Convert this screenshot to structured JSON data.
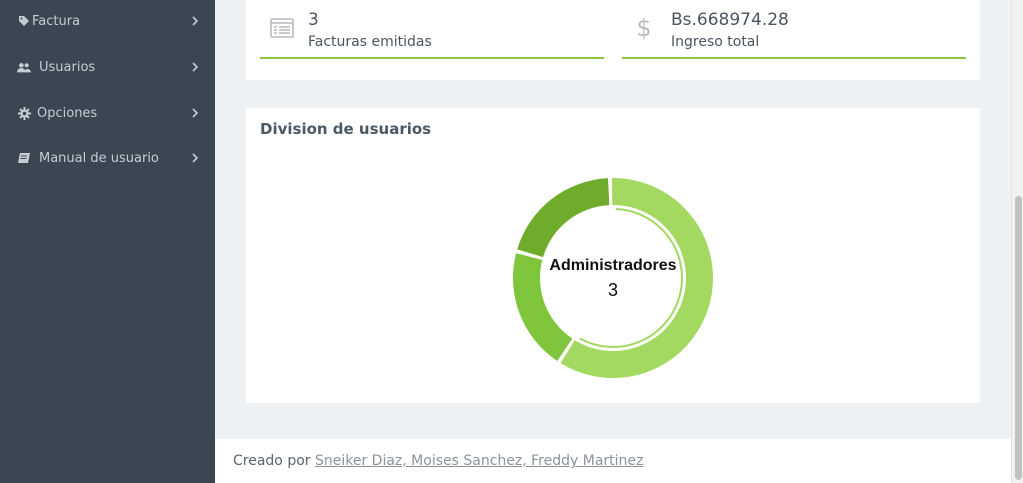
{
  "sidebar": {
    "items": [
      {
        "label": "Factura",
        "icon": "tag-icon"
      },
      {
        "label": "Usuarios",
        "icon": "users-icon"
      },
      {
        "label": "Opciones",
        "icon": "gear-icon"
      },
      {
        "label": "Manual de usuario",
        "icon": "book-icon"
      }
    ]
  },
  "stats": [
    {
      "value": "3",
      "label": "Facturas emitidas",
      "icon": "list-icon"
    },
    {
      "value": "Bs.668974.28",
      "label": "Ingreso total",
      "icon": "dollar-icon"
    }
  ],
  "chart": {
    "title": "Division de usuarios",
    "center_name": "Administradores",
    "center_value": "3"
  },
  "chart_data": {
    "type": "pie",
    "style": "donut",
    "title": "Division de usuarios",
    "series": [
      {
        "value": 0.56,
        "color": "#a3d961"
      },
      {
        "value": 0.19,
        "color": "#80c63c"
      },
      {
        "value": 0.19,
        "color": "#6fac2c"
      }
    ],
    "highlighted": {
      "label": "Administradores",
      "value": 3
    }
  },
  "footer": {
    "prefix": "Creado por",
    "authors": "Sneiker Diaz, Moises Sanchez, Freddy Martinez"
  },
  "colors": {
    "sidebar_bg": "#3a4651",
    "accent_green": "#8cc63f",
    "page_bg": "#eef1f4"
  }
}
